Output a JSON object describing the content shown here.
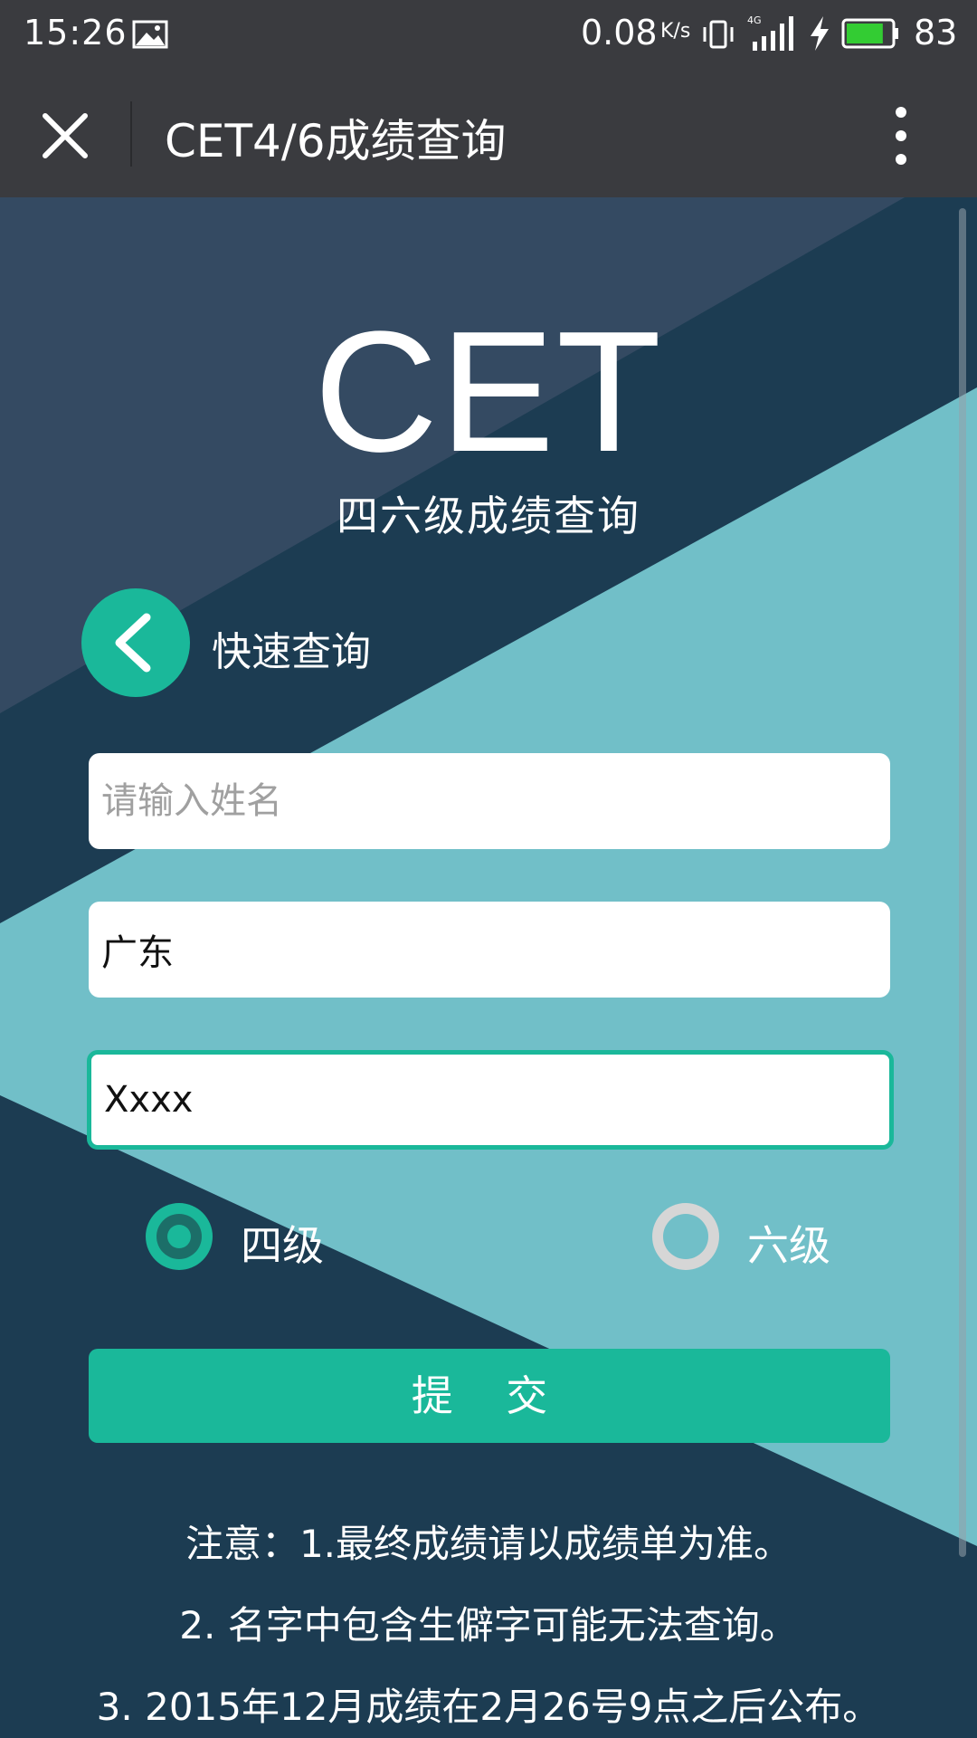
{
  "status_bar": {
    "time": "15:26",
    "net_speed": "0.08",
    "net_speed_unit": "K/s",
    "network_type": "4G",
    "battery_percent": "83",
    "battery_level": 0.83,
    "icons": [
      "image-icon",
      "vibrate-icon",
      "signal-icon",
      "charging-icon",
      "battery-icon"
    ]
  },
  "title_bar": {
    "title": "CET4/6成绩查询",
    "close_icon": "close-icon",
    "more_icon": "more-vertical-icon"
  },
  "hero": {
    "logo": "CET",
    "subtitle": "四六级成绩查询"
  },
  "quick_query": {
    "label": "快速查询",
    "icon": "chevron-left-icon"
  },
  "form": {
    "name": {
      "value": "",
      "placeholder": "请输入姓名"
    },
    "region": {
      "value": "广东",
      "placeholder": ""
    },
    "id_number": {
      "value": "Xxxx",
      "placeholder": ""
    },
    "levels": [
      {
        "label": "四级",
        "selected": true
      },
      {
        "label": "六级",
        "selected": false
      }
    ],
    "submit_label": "提 交"
  },
  "notes": [
    "注意：1.最终成绩请以成绩单为准。",
    "2. 名字中包含生僻字可能无法查询。",
    "3. 2015年12月成绩在2月26号9点之后公布。"
  ],
  "colors": {
    "bar": "#3a3b3f",
    "dark_bg": "#1c3c52",
    "slate": "#344a62",
    "light_teal": "#71bfc8",
    "accent": "#1ab89a"
  }
}
